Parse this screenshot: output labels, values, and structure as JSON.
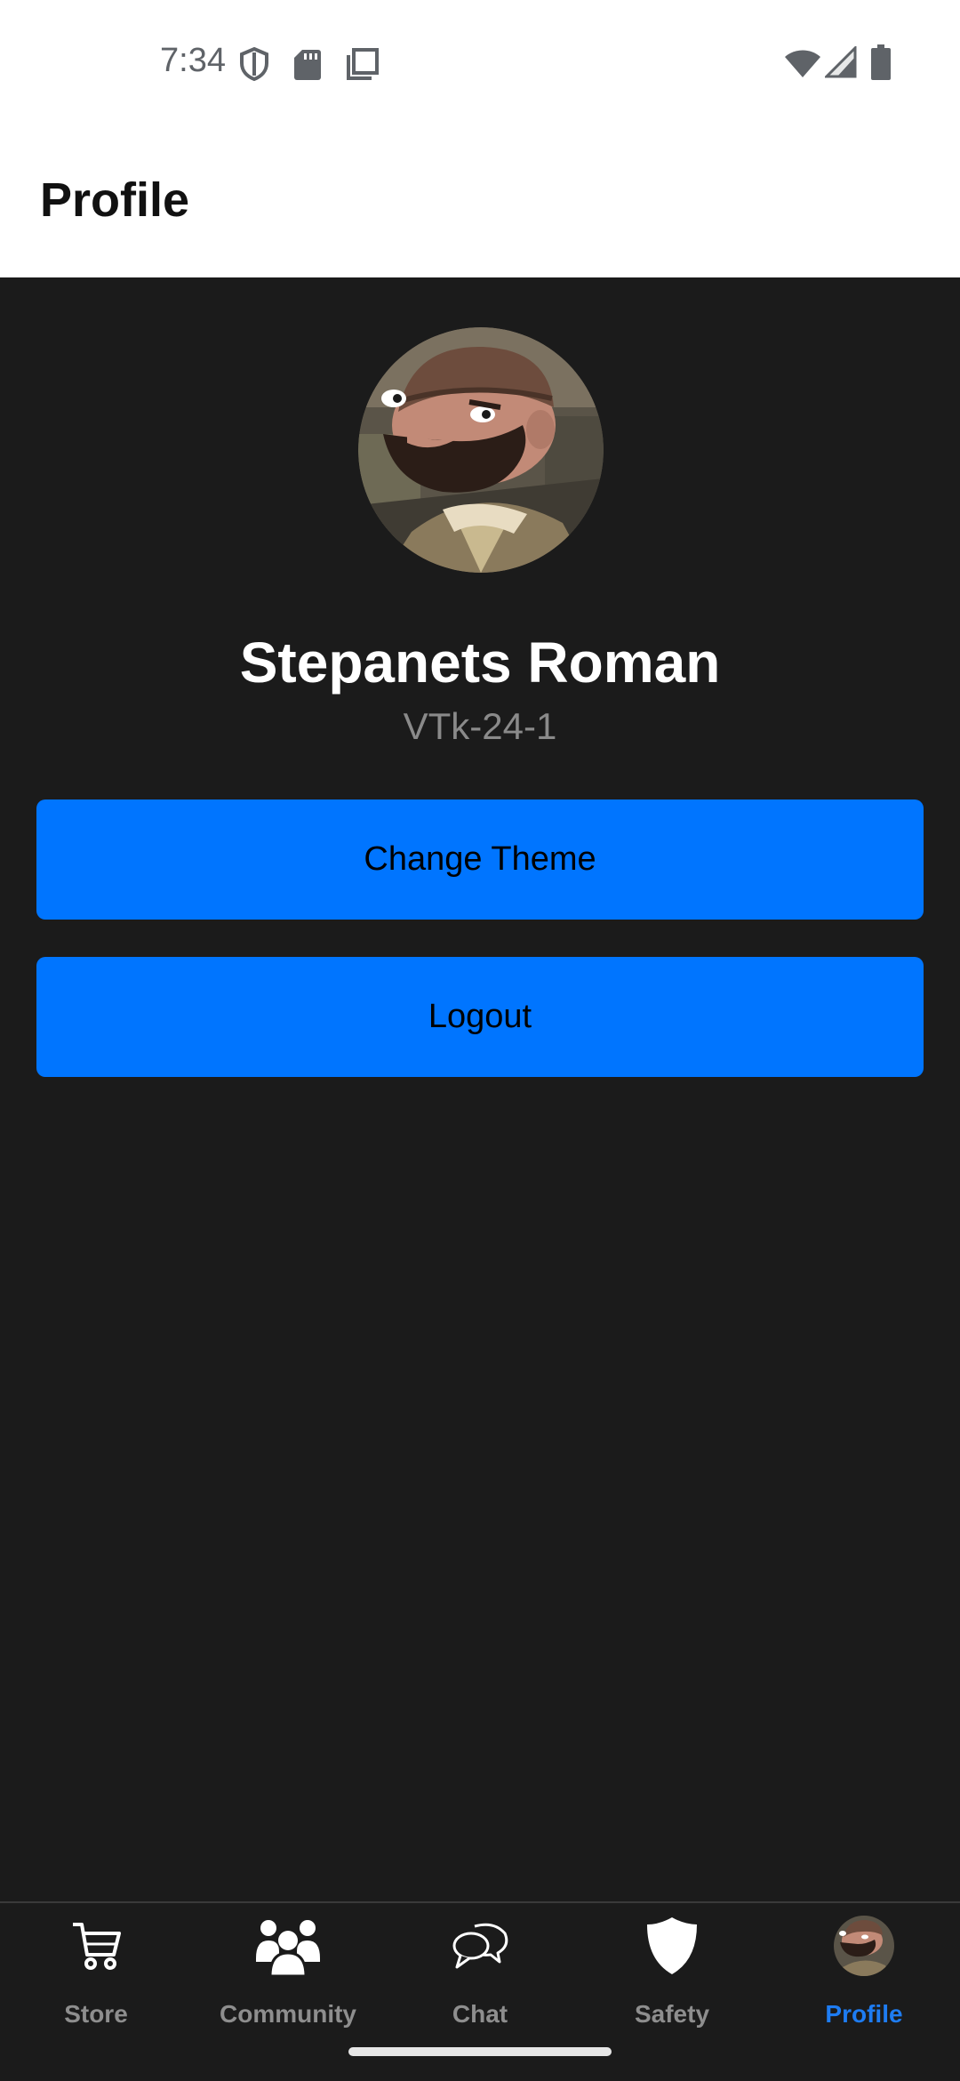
{
  "status_bar": {
    "time": "7:34",
    "icons": [
      "shield-icon",
      "sd-card-icon",
      "copy-icon",
      "wifi-icon",
      "signal-icon",
      "battery-icon"
    ]
  },
  "header": {
    "title": "Profile"
  },
  "profile": {
    "name": "Stepanets Roman",
    "group": "VTk-24-1",
    "avatar": "avatar-cartoon-bearded-man"
  },
  "actions": {
    "change_theme_label": "Change Theme",
    "logout_label": "Logout"
  },
  "bottom_nav": {
    "items": [
      {
        "label": "Store",
        "icon": "cart-icon"
      },
      {
        "label": "Community",
        "icon": "community-icon"
      },
      {
        "label": "Chat",
        "icon": "chat-icon"
      },
      {
        "label": "Safety",
        "icon": "shield-icon"
      },
      {
        "label": "Profile",
        "icon": "avatar-icon"
      }
    ],
    "active_index": 4
  },
  "colors": {
    "background": "#1b1b1b",
    "accent": "#0075ff",
    "active_nav": "#1e7cf2",
    "inactive_nav": "#8e8e8e"
  }
}
